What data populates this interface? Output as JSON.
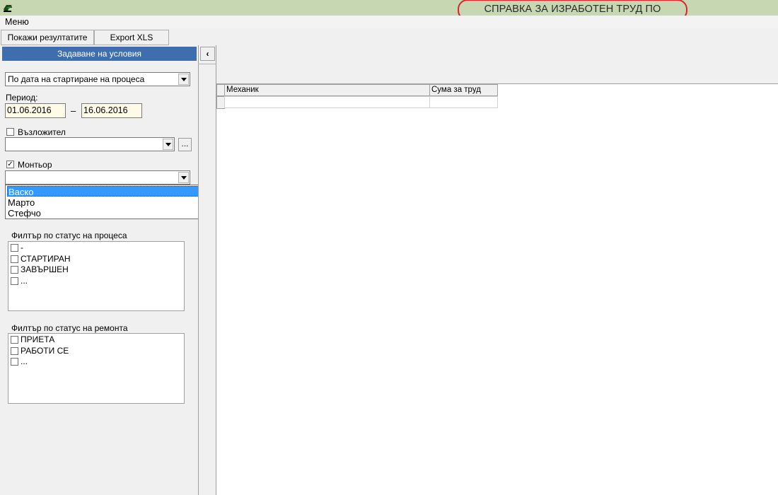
{
  "window": {
    "title": "СПРАВКА ЗА ИЗРАБОТЕН ТРУД ПО ПРОЦЕСИ",
    "accent": "#d9262b"
  },
  "menu": {
    "label": "Меню"
  },
  "toolbar": {
    "show_results_label": "Покажи резултатите",
    "export_label": "Export XLS"
  },
  "conditions": {
    "header": "Задаване на условия",
    "date_mode": "По дата на стартиране на процеса",
    "period_label": "Период:",
    "date_from": "01.06.2016",
    "date_separator": "–",
    "date_to": "16.06.2016",
    "assigner_label": "Възложител",
    "assigner_checked": false,
    "assigner_value": "",
    "browse_label": "...",
    "mechanic_label": "Монтьор",
    "mechanic_checked": true,
    "check_glyph": "✓",
    "mechanic_value": "",
    "mechanic_options": [
      "Васко",
      "Марто",
      "Стефчо"
    ],
    "mechanic_selected_index": 0
  },
  "process_filter": {
    "label": "Филтър по статус на процеса",
    "items": [
      "-",
      "СТАРТИРАН",
      "ЗАВЪРШЕН",
      "..."
    ]
  },
  "repair_filter": {
    "label": "Филтър по статус на ремонта",
    "items": [
      "ПРИЕТА",
      "РАБОТИ СЕ",
      "..."
    ]
  },
  "grid": {
    "columns": [
      "Механик",
      "Сума за труд"
    ]
  },
  "collapse_glyph": "‹",
  "colors": {
    "title_bar": "#c7d7b2",
    "panel_header": "#3e6ead",
    "selection": "#3399ff"
  }
}
